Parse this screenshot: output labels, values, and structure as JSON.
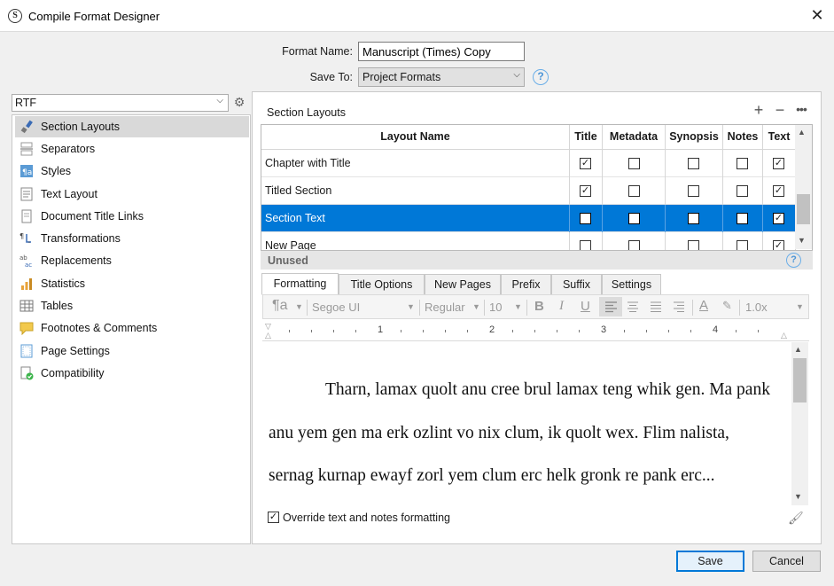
{
  "window": {
    "title": "Compile Format Designer"
  },
  "header": {
    "format_name_label": "Format Name:",
    "format_name_value": "Manuscript (Times) Copy",
    "save_to_label": "Save To:",
    "save_to_value": "Project Formats"
  },
  "left": {
    "output_type": "RTF",
    "items": [
      {
        "label": "Section Layouts",
        "icon": "paintbrush-icon",
        "selected": true
      },
      {
        "label": "Separators",
        "icon": "separator-icon"
      },
      {
        "label": "Styles",
        "icon": "styles-icon"
      },
      {
        "label": "Text Layout",
        "icon": "text-layout-icon"
      },
      {
        "label": "Document Title Links",
        "icon": "document-icon"
      },
      {
        "label": "Transformations",
        "icon": "transformations-icon"
      },
      {
        "label": "Replacements",
        "icon": "replacements-icon"
      },
      {
        "label": "Statistics",
        "icon": "bar-chart-icon"
      },
      {
        "label": "Tables",
        "icon": "table-icon"
      },
      {
        "label": "Footnotes & Comments",
        "icon": "note-icon"
      },
      {
        "label": "Page Settings",
        "icon": "page-icon"
      },
      {
        "label": "Compatibility",
        "icon": "compatibility-icon"
      }
    ]
  },
  "section_layouts": {
    "title": "Section Layouts",
    "columns": [
      "Layout Name",
      "Title",
      "Metadata",
      "Synopsis",
      "Notes",
      "Text"
    ],
    "rows": [
      {
        "name": "Chapter with Title",
        "checks": [
          true,
          false,
          false,
          false,
          true
        ]
      },
      {
        "name": "Titled Section",
        "checks": [
          true,
          false,
          false,
          false,
          true
        ]
      },
      {
        "name": "Section Text",
        "checks": [
          false,
          false,
          false,
          false,
          true
        ],
        "selected": true
      },
      {
        "name": "New Page",
        "checks": [
          false,
          false,
          false,
          false,
          true
        ]
      }
    ],
    "unused_label": "Unused"
  },
  "tabs": [
    "Formatting",
    "Title Options",
    "New Pages",
    "Prefix",
    "Suffix",
    "Settings"
  ],
  "toolbar": {
    "font": "Segoe UI",
    "style": "Regular",
    "size": "10",
    "line_spacing": "1.0x"
  },
  "ruler": [
    "1",
    "2",
    "3",
    "4"
  ],
  "editor": {
    "sample_text": "Tharn, lamax quolt anu cree brul lamax teng whik gen. Ma pank anu yem gen ma erk ozlint vo nix clum, ik quolt wex. Flim nalista, sernag kurnap ewayf zorl yem clum erc helk gronk re pank erc..."
  },
  "override": {
    "label": "Override text and notes formatting",
    "checked": true
  },
  "buttons": {
    "save": "Save",
    "cancel": "Cancel"
  }
}
